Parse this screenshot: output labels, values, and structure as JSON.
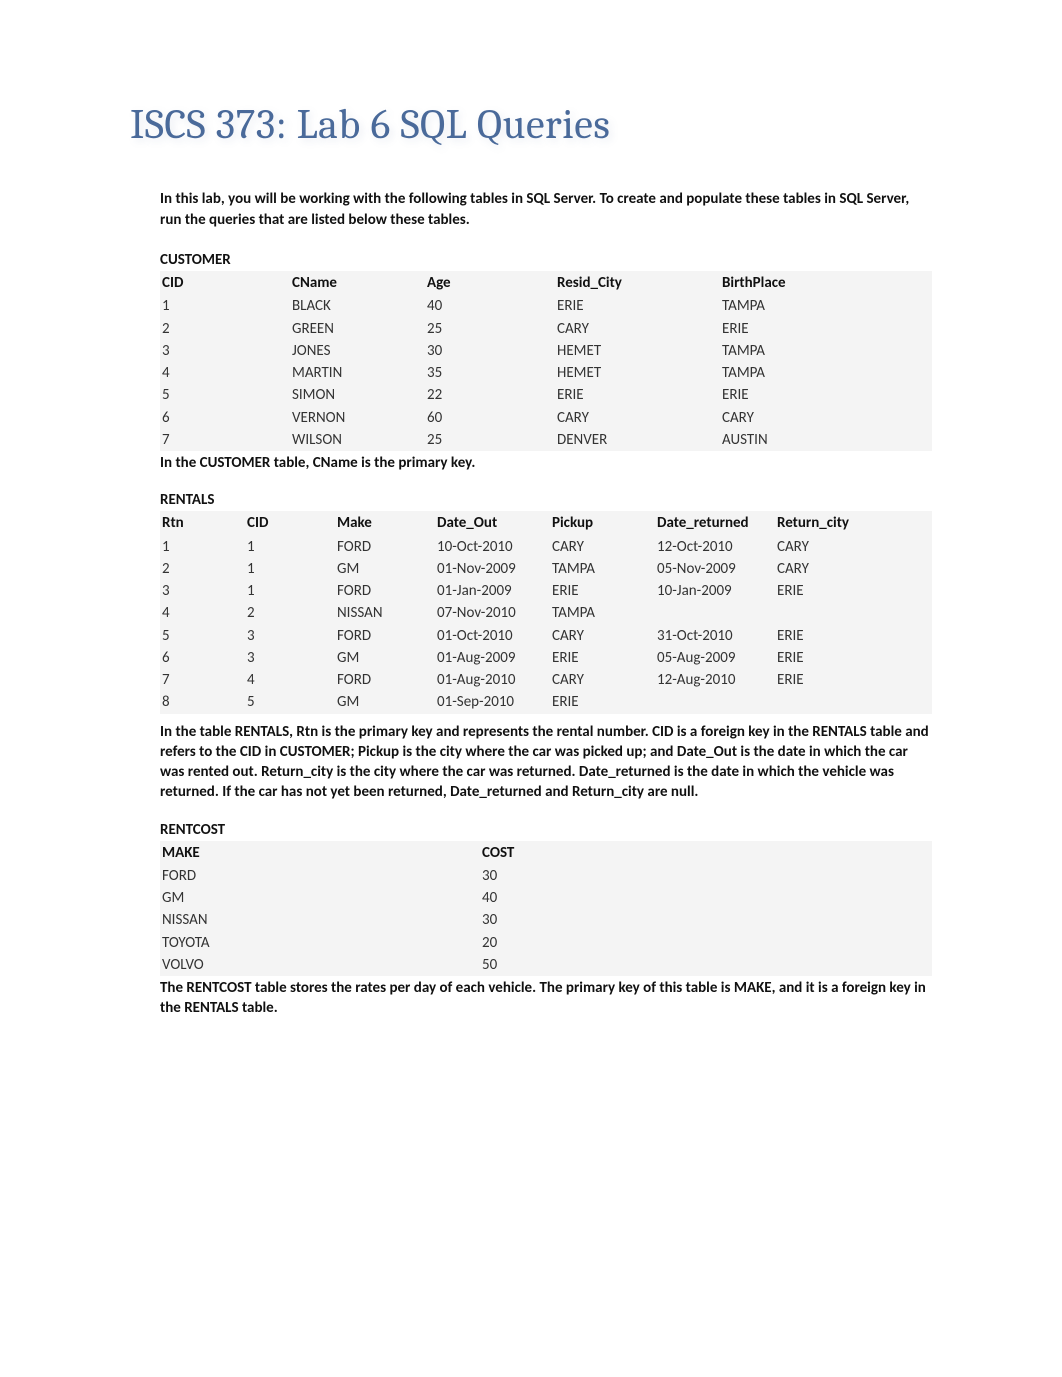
{
  "title": "ISCS 373:  Lab 6 SQL Queries",
  "intro": "In this lab, you will be working with the following tables in SQL Server.  To create and populate these tables in SQL Server, run the queries that are listed below these tables.",
  "customer": {
    "heading": "CUSTOMER",
    "headers": [
      "CID",
      "CName",
      "Age",
      "Resid_City",
      "BirthPlace"
    ],
    "rows": [
      [
        "1",
        "BLACK",
        "40",
        "ERIE",
        "TAMPA"
      ],
      [
        "2",
        "GREEN",
        "25",
        "CARY",
        "ERIE"
      ],
      [
        "3",
        "JONES",
        "30",
        "HEMET",
        "TAMPA"
      ],
      [
        "4",
        "MARTIN",
        "35",
        "HEMET",
        "TAMPA"
      ],
      [
        "5",
        "SIMON",
        "22",
        "ERIE",
        "ERIE"
      ],
      [
        "6",
        "VERNON",
        "60",
        "CARY",
        "CARY"
      ],
      [
        "7",
        "WILSON",
        "25",
        "DENVER",
        "AUSTIN"
      ]
    ],
    "note": "In the CUSTOMER table, CName is the primary key."
  },
  "rentals": {
    "heading": "RENTALS",
    "headers": [
      "Rtn",
      "CID",
      "Make",
      "Date_Out",
      "Pickup",
      "Date_returned",
      "Return_city"
    ],
    "rows": [
      [
        "1",
        "1",
        "FORD",
        "10-Oct-2010",
        "CARY",
        "12-Oct-2010",
        "CARY"
      ],
      [
        "2",
        "1",
        "GM",
        "01-Nov-2009",
        "TAMPA",
        "05-Nov-2009",
        "CARY"
      ],
      [
        "3",
        "1",
        "FORD",
        "01-Jan-2009",
        "ERIE",
        "10-Jan-2009",
        "ERIE"
      ],
      [
        "4",
        "2",
        "NISSAN",
        "07-Nov-2010",
        "TAMPA",
        "",
        ""
      ],
      [
        "5",
        "3",
        "FORD",
        "01-Oct-2010",
        "CARY",
        "31-Oct-2010",
        "ERIE"
      ],
      [
        "6",
        "3",
        "GM",
        "01-Aug-2009",
        "ERIE",
        "05-Aug-2009",
        "ERIE"
      ],
      [
        "7",
        "4",
        "FORD",
        "01-Aug-2010",
        "CARY",
        "12-Aug-2010",
        "ERIE"
      ],
      [
        "8",
        "5",
        "GM",
        "01-Sep-2010",
        "ERIE",
        "",
        ""
      ]
    ],
    "note": "In the table RENTALS, Rtn is the primary key and represents the rental number. CID is a foreign key in the RENTALS table and refers to the CID in CUSTOMER; Pickup is the city where the car was picked up; and Date_Out is the date in which the car was rented out.   Return_city is the city where the car was returned.  Date_returned is the date in which the vehicle was returned.  If the car has not yet been returned,  Date_returned and Return_city are null."
  },
  "rentcost": {
    "heading": "RENTCOST",
    "headers": [
      "MAKE",
      "COST"
    ],
    "rows": [
      [
        "FORD",
        "30"
      ],
      [
        "GM",
        "40"
      ],
      [
        "NISSAN",
        "30"
      ],
      [
        "TOYOTA",
        "20"
      ],
      [
        "VOLVO",
        "50"
      ]
    ],
    "note": "The RENTCOST table stores the rates per day of each vehicle.  The primary key of this table is MAKE, and it is a foreign key in the RENTALS table."
  }
}
